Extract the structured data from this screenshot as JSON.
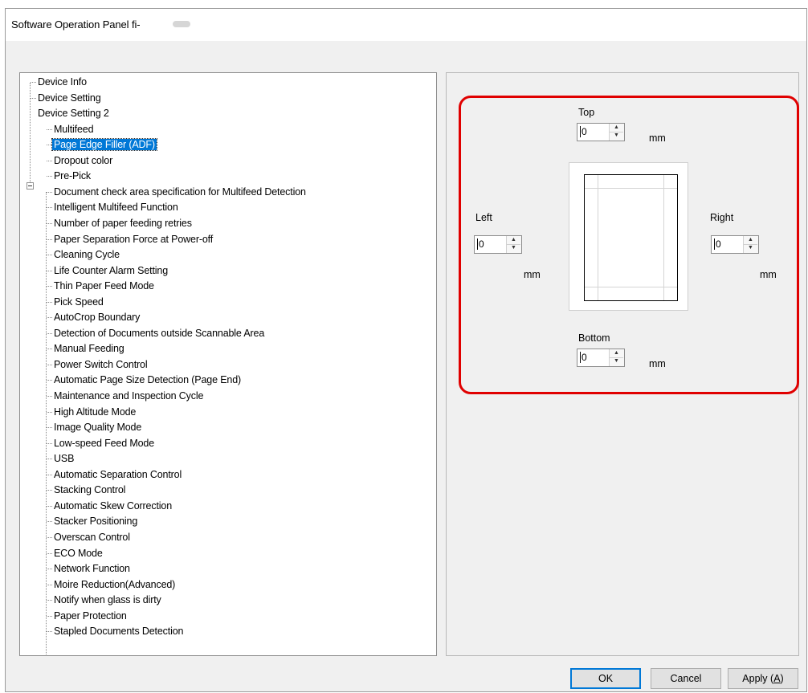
{
  "window": {
    "title": "Software Operation Panel fi-"
  },
  "tree": {
    "items": [
      "Device Info",
      "Device Setting",
      "Device Setting 2",
      "Multifeed",
      "Page Edge Filler (ADF)",
      "Dropout color",
      "Pre-Pick",
      "Document check area specification for Multifeed Detection",
      "Intelligent Multifeed Function",
      "Number of paper feeding retries",
      "Paper Separation Force at Power-off",
      "Cleaning Cycle",
      "Life Counter Alarm Setting",
      "Thin Paper Feed Mode",
      "Pick Speed",
      "AutoCrop Boundary",
      "Detection of Documents outside Scannable Area",
      "Manual Feeding",
      "Power Switch Control",
      "Automatic Page Size Detection (Page End)",
      "Maintenance and Inspection Cycle",
      "High Altitude Mode",
      "Image Quality Mode",
      "Low-speed Feed Mode",
      "USB",
      "Automatic Separation Control",
      "Stacking Control",
      "Automatic Skew Correction",
      "Stacker Positioning",
      "Overscan Control",
      "ECO Mode",
      "Network Function",
      "Moire Reduction(Advanced)",
      "Notify when glass is dirty",
      "Paper Protection",
      "Stapled Documents Detection"
    ],
    "selected": "Page Edge Filler (ADF)"
  },
  "edge_filler": {
    "top": {
      "label": "Top",
      "value": "0",
      "unit": "mm"
    },
    "left": {
      "label": "Left",
      "value": "0",
      "unit": "mm"
    },
    "right": {
      "label": "Right",
      "value": "0",
      "unit": "mm"
    },
    "bottom": {
      "label": "Bottom",
      "value": "0",
      "unit": "mm"
    }
  },
  "buttons": {
    "ok": "OK",
    "cancel": "Cancel",
    "apply": "Apply (",
    "apply_key": "A",
    "apply_end": ")"
  },
  "colors": {
    "selection": "#0078d7",
    "highlight_border": "#e00000"
  }
}
